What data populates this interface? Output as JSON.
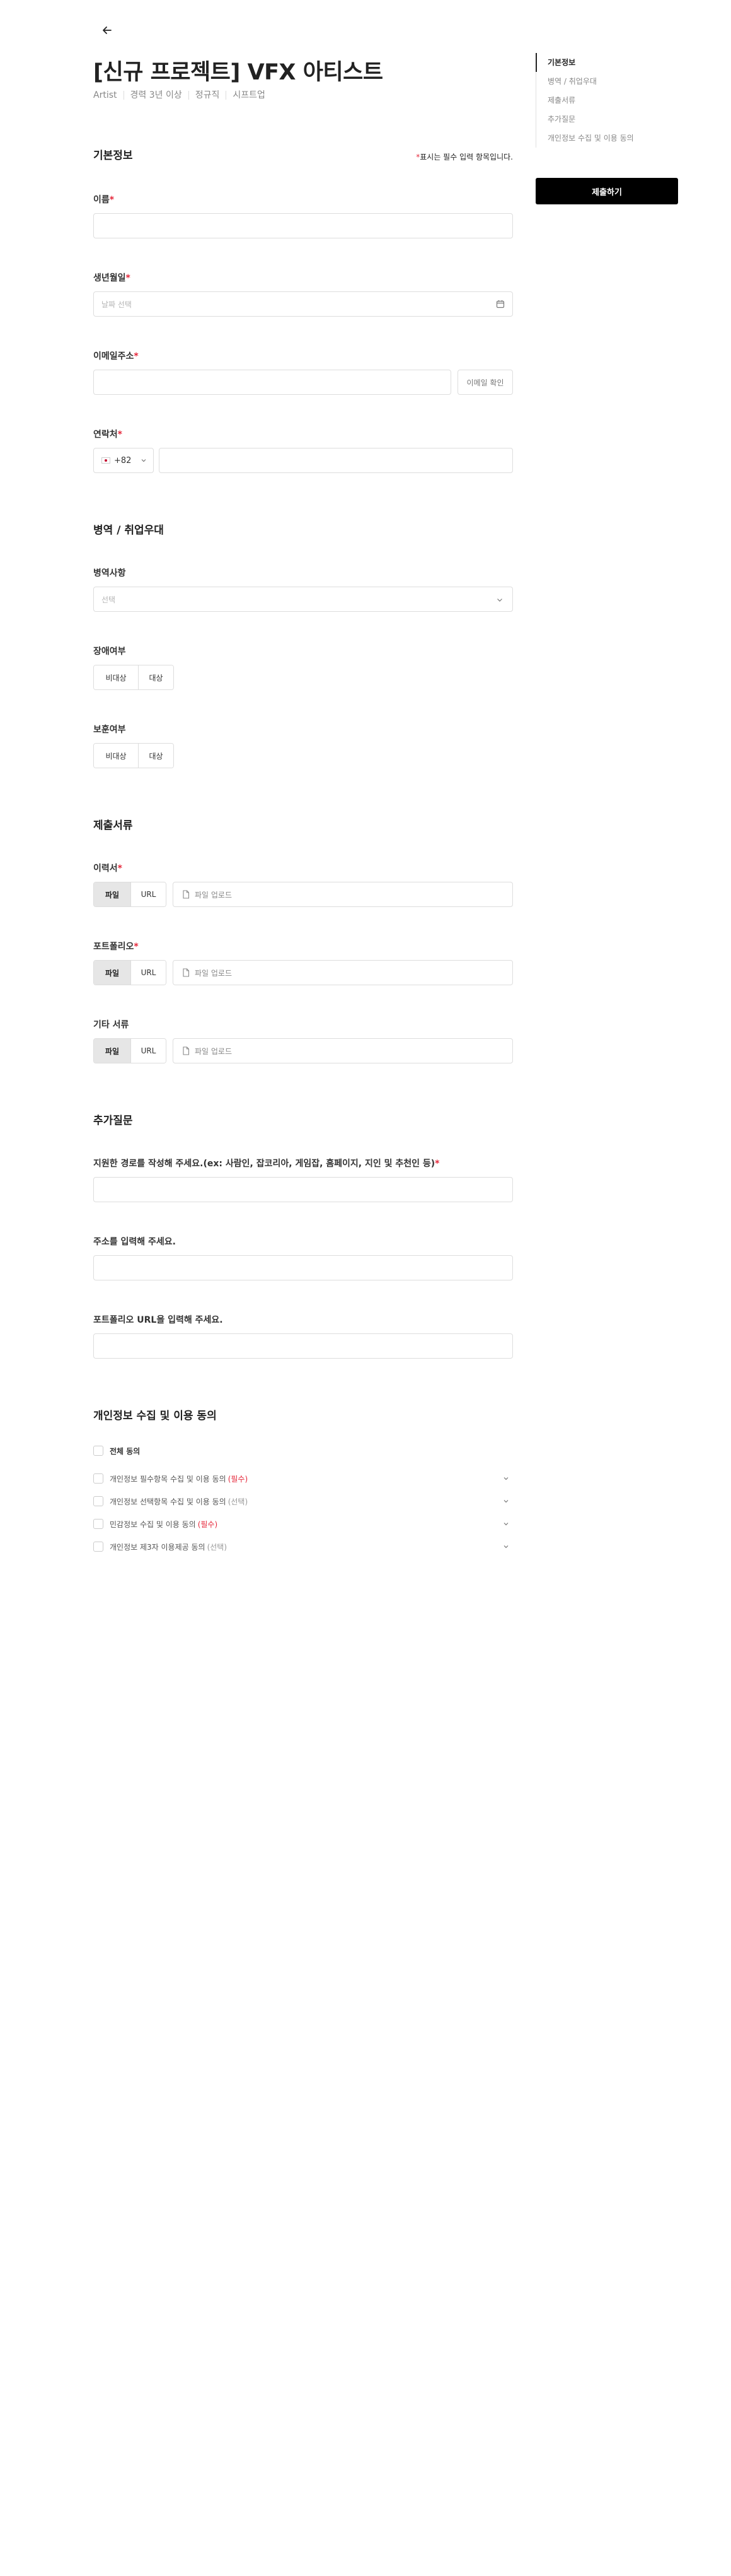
{
  "header": {
    "title": "[신규 프로젝트] VFX 아티스트",
    "meta": [
      "Artist",
      "경력 3년 이상",
      "정규직",
      "시프트업"
    ]
  },
  "sidebar": {
    "items": [
      {
        "label": "기본정보",
        "active": true
      },
      {
        "label": "병역 / 취업우대",
        "active": false
      },
      {
        "label": "제출서류",
        "active": false
      },
      {
        "label": "추가질문",
        "active": false
      },
      {
        "label": "개인정보 수집 및 이용 동의",
        "active": false
      }
    ],
    "submit_label": "제출하기"
  },
  "basic": {
    "title": "기본정보",
    "required_note_star": "*",
    "required_note": "표시는 필수 입력 항목입니다.",
    "name_label": "이름",
    "birth_label": "생년월일",
    "birth_placeholder": "날짜 선택",
    "email_label": "이메일주소",
    "email_check": "이메일 확인",
    "phone_label": "연락처",
    "country_code": "+82",
    "star": "*"
  },
  "military": {
    "title": "병역 / 취업우대",
    "military_label": "병역사항",
    "military_placeholder": "선택",
    "disability_label": "장애여부",
    "veteran_label": "보훈여부",
    "opt_no": "비대상",
    "opt_yes": "대상"
  },
  "documents": {
    "title": "제출서류",
    "resume_label": "이력서",
    "portfolio_label": "포트폴리오",
    "other_label": "기타 서류",
    "file_tab": "파일",
    "url_tab": "URL",
    "upload_placeholder": "파일 업로드"
  },
  "questions": {
    "title": "추가질문",
    "q1": "지원한 경로를 작성해 주세요.(ex: 사람인, 잡코리아, 게임잡, 홈페이지, 지인 및 추천인 등)",
    "q2": "주소를 입력해 주세요.",
    "q3": "포트폴리오 URL을 입력해 주세요."
  },
  "consent": {
    "title": "개인정보 수집 및 이용 동의",
    "all": "전체 동의",
    "items": [
      {
        "label": "개인정보 필수항목 수집 및 이용 동의",
        "tag": "(필수)",
        "required": true
      },
      {
        "label": "개인정보 선택항목 수집 및 이용 동의",
        "tag": "(선택)",
        "required": false
      },
      {
        "label": "민감정보 수집 및 이용 동의",
        "tag": "(필수)",
        "required": true
      },
      {
        "label": "개인정보 제3자 이용제공 동의",
        "tag": "(선택)",
        "required": false
      }
    ]
  }
}
